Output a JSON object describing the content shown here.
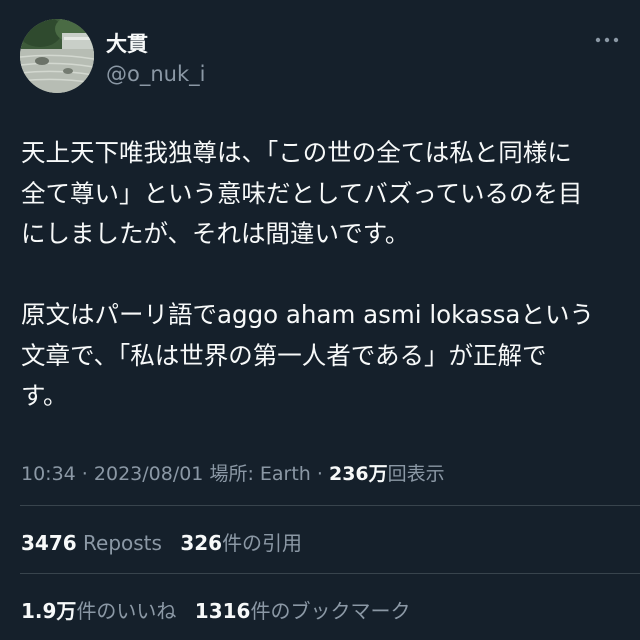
{
  "author": {
    "display_name": "大貫",
    "handle": "@o_nuk_i",
    "avatar_icon": "zen-garden-avatar"
  },
  "menu": {
    "more_icon": "more-horizontal-icon"
  },
  "tweet": {
    "lines": [
      "天上天下唯我独尊は、「この世の全ては私と同様に",
      "全て尊い」という意味だとしてバズっているのを目",
      "にしましたが、それは間違いです。",
      "",
      "原文はパーリ語でaggo aham asmi lokassaという",
      "文章で、「私は世界の第一人者である」が正解で",
      "す。"
    ]
  },
  "meta": {
    "time": "10:34",
    "sep1": " · ",
    "date": "2023/08/01",
    "location_label": "場所: Earth",
    "sep2": " · ",
    "views_count": "236万",
    "views_label": "回表示"
  },
  "stats": {
    "reposts_count": "3476",
    "reposts_label": "Reposts",
    "quotes_count": "326",
    "quotes_label": "件の引用",
    "likes_count": "1.9万",
    "likes_label": "件のいいね",
    "bookmarks_count": "1316",
    "bookmarks_label": "件のブックマーク"
  },
  "colors": {
    "background": "#15202b",
    "text_primary": "#f7f9f9",
    "text_secondary": "#8b98a5",
    "divider": "#38444d"
  }
}
